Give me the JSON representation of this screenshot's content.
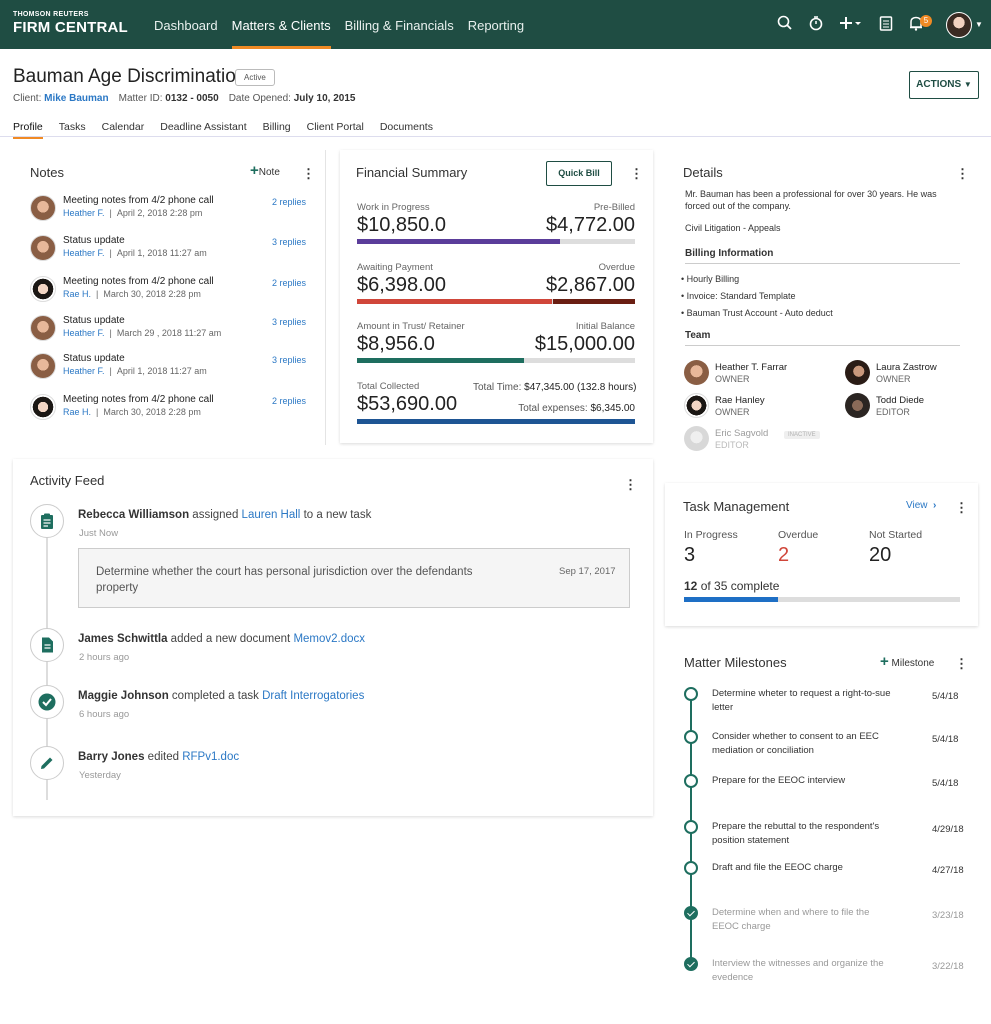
{
  "brand": {
    "top": "THOMSON REUTERS",
    "bottom": "FIRM CENTRAL"
  },
  "nav": [
    "Dashboard",
    "Matters & Clients",
    "Billing & Financials",
    "Reporting"
  ],
  "notifications_count": "5",
  "matter": {
    "title": "Bauman Age Discrimination",
    "status": "Active",
    "client_label": "Client:",
    "client": "Mike Bauman",
    "matter_id_label": "Matter ID:",
    "matter_id": "0132 - 0050",
    "date_label": "Date Opened:",
    "date": "July 10, 2015",
    "actions": "ACTIONS"
  },
  "tabs": [
    "Profile",
    "Tasks",
    "Calendar",
    "Deadline Assistant",
    "Billing",
    "Client Portal",
    "Documents"
  ],
  "notes": {
    "title": "Notes",
    "add_label": "Note",
    "items": [
      {
        "title": "Meeting notes from 4/2 phone call",
        "who": "Heather F.",
        "when": "April 2, 2018  2:28 pm",
        "replies": "2 replies",
        "avatar": "heather"
      },
      {
        "title": "Status update",
        "who": "Heather F.",
        "when": "April 1, 2018  11:27 am",
        "replies": "3 replies",
        "avatar": "heather"
      },
      {
        "title": "Meeting notes from 4/2 phone call",
        "who": "Rae H.",
        "when": "March 30, 2018  2:28 pm",
        "replies": "2 replies",
        "avatar": "rae"
      },
      {
        "title": "Status update",
        "who": "Heather F.",
        "when": "March 29 , 2018  11:27 am",
        "replies": "3 replies",
        "avatar": "heather"
      },
      {
        "title": "Status update",
        "who": "Heather F.",
        "when": "April 1, 2018  11:27 am",
        "replies": "3 replies",
        "avatar": "heather"
      },
      {
        "title": "Meeting notes from 4/2 phone call",
        "who": "Rae H.",
        "when": "March 30, 2018  2:28 pm",
        "replies": "2 replies",
        "avatar": "rae"
      }
    ]
  },
  "financial": {
    "title": "Financial Summary",
    "quick_bill": "Quick Bill",
    "rows": [
      {
        "left_label": "Work in Progress",
        "left_value": "$10,850.0",
        "right_label": "Pre-Billed",
        "right_value": "$4,772.00",
        "fill": 0.73,
        "color": "#5b3d9a"
      },
      {
        "left_label": "Awaiting Payment",
        "left_value": "$6,398.00",
        "right_label": "Overdue",
        "right_value": "$2,867.00",
        "fill": 0.7,
        "color": "#d0463a",
        "color2": "#6a1e12"
      },
      {
        "left_label": "Amount in Trust/ Retainer",
        "left_value": "$8,956.0",
        "right_label": "Initial Balance",
        "right_value": "$15,000.00",
        "fill": 0.6,
        "color": "#1e6e5f"
      }
    ],
    "total_collected_label": "Total Collected",
    "total_collected": "$53,690.00",
    "total_time_label": "Total Time:",
    "total_time": "$47,345.00 (132.8 hours)",
    "total_expenses_label": "Total expenses:",
    "total_expenses": "$6,345.00"
  },
  "details": {
    "title": "Details",
    "description": "Mr. Bauman has been a professional for over 30 years. He was forced out of the company.",
    "practice": "Civil Litigation  - Appeals",
    "billing_title": "Billing Information",
    "billing_items": [
      "Hourly Billing",
      "Invoice: Standard Template",
      "Bauman Trust Account - Auto deduct"
    ],
    "team_title": "Team",
    "team": [
      {
        "name": "Heather T. Farrar",
        "role": "OWNER"
      },
      {
        "name": "Laura Zastrow",
        "role": "OWNER"
      },
      {
        "name": "Rae Hanley",
        "role": "OWNER"
      },
      {
        "name": "Todd Diede",
        "role": "EDITOR"
      },
      {
        "name": "Eric Sagvold",
        "role": "EDITOR",
        "badge": "INACTIVE"
      }
    ]
  },
  "activity": {
    "title": "Activity Feed",
    "items": [
      {
        "actor": "Rebecca Williamson",
        "verb": " assigned ",
        "target": "Lauren Hall",
        "rest": " to a new task",
        "time": "Just Now",
        "icon": "clipboard-icon",
        "box_text": "Determine whether the court has personal jurisdiction over the defendants property",
        "box_date": "Sep 17, 2017"
      },
      {
        "actor": "James Schwittla",
        "verb": " added a new document ",
        "target": "Memov2.docx",
        "rest": "",
        "time": "2 hours ago",
        "icon": "document-icon"
      },
      {
        "actor": "Maggie Johnson",
        "verb": " completed a task ",
        "target": "Draft Interrogatories",
        "rest": "",
        "time": "6 hours ago",
        "icon": "check-circle-icon"
      },
      {
        "actor": "Barry Jones",
        "verb": " edited ",
        "target": "RFPv1.doc",
        "rest": "",
        "time": "Yesterday",
        "icon": "pencil-icon"
      }
    ]
  },
  "tasks": {
    "title": "Task Management",
    "view": "View",
    "in_progress_label": "In Progress",
    "in_progress": "3",
    "overdue_label": "Overdue",
    "overdue": "2",
    "not_started_label": "Not Started",
    "not_started": "20",
    "complete_count": "12",
    "complete_text": "of 35 complete",
    "progress": 0.34
  },
  "milestones": {
    "title": "Matter Milestones",
    "add_label": "Milestone",
    "items": [
      {
        "text": "Determine wheter to request a right-to-sue letter",
        "date": "5/4/18",
        "done": false
      },
      {
        "text": "Consider whether to consent to an EEC mediation or conciliation",
        "date": "5/4/18",
        "done": false
      },
      {
        "text": "Prepare for the EEOC interview",
        "date": "5/4/18",
        "done": false
      },
      {
        "text": "Prepare the rebuttal to the respondent's position statement",
        "date": "4/29/18",
        "done": false
      },
      {
        "text": "Draft and file the EEOC charge",
        "date": "4/27/18",
        "done": false
      },
      {
        "text": "Determine when and where to file the EEOC charge",
        "date": "3/23/18",
        "done": true
      },
      {
        "text": "Interview the witnesses and organize the evedence",
        "date": "3/22/18",
        "done": true
      }
    ]
  }
}
